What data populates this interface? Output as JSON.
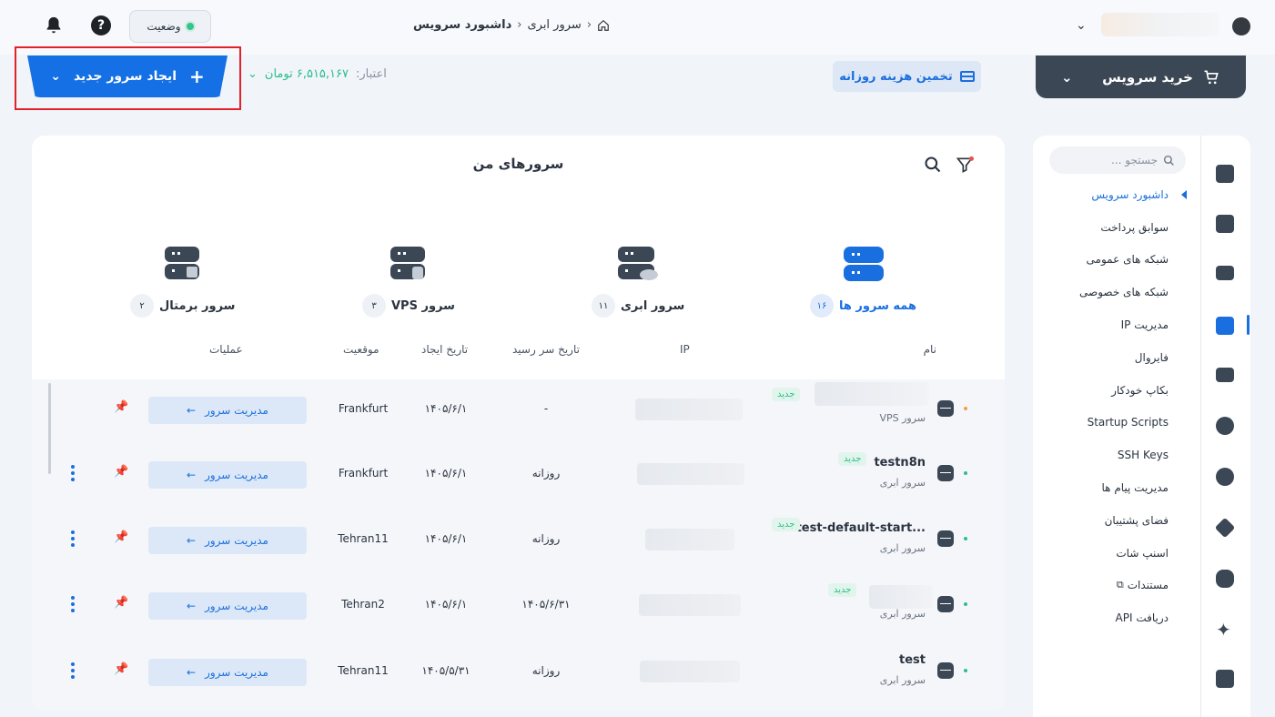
{
  "header": {
    "status_label": "وضعیت",
    "breadcrumb": [
      "داشبورد سرویس",
      "سرور ابری"
    ],
    "help_label": "?"
  },
  "actions": {
    "create_server": "ایجاد سرور جدید",
    "credit_label": "اعتبار:",
    "credit_value": "۶,۵۱۵,۱۶۷ تومان",
    "estimate_daily": "تخمین هزینه روزانه",
    "buy_service": "خرید سرویس"
  },
  "main": {
    "title": "سرورهای من",
    "categories": [
      {
        "label": "همه سرور ها",
        "count": "۱۶"
      },
      {
        "label": "سرور ابری",
        "count": "۱۱"
      },
      {
        "label": "سرور VPS",
        "count": "۳"
      },
      {
        "label": "سرور برمتال",
        "count": "۲"
      }
    ],
    "columns": {
      "name": "نام",
      "ip": "IP",
      "due": "تاریخ سر رسید",
      "created": "تاریخ ایجاد",
      "location": "موقعیت",
      "operations": "عملیات"
    },
    "new_badge": "جدید",
    "manage_label": "مدیریت سرور",
    "rows": [
      {
        "name": "",
        "type": "سرور VPS",
        "due": "-",
        "created": "۱۴۰۵/۶/۱",
        "location": "Frankfurt"
      },
      {
        "name": "testn8n",
        "type": "سرور ابری",
        "due": "روزانه",
        "created": "۱۴۰۵/۶/۱",
        "location": "Frankfurt"
      },
      {
        "name": "test-default-start...",
        "type": "سرور ابری",
        "due": "روزانه",
        "created": "۱۴۰۵/۶/۱",
        "location": "Tehran11"
      },
      {
        "name": "",
        "type": "سرور ابری",
        "due": "۱۴۰۵/۶/۳۱",
        "created": "۱۴۰۵/۶/۱",
        "location": "Tehran2"
      },
      {
        "name": "test",
        "type": "سرور ابری",
        "due": "روزانه",
        "created": "۱۴۰۵/۵/۳۱",
        "location": "Tehran11"
      }
    ]
  },
  "sidebar": {
    "search_placeholder": "جستجو ...",
    "items": [
      {
        "label": "داشبورد سرویس"
      },
      {
        "label": "سوابق پرداخت"
      },
      {
        "label": "شبکه های عمومی"
      },
      {
        "label": "شبکه های خصوصی"
      },
      {
        "label": "مدیریت IP"
      },
      {
        "label": "فایروال"
      },
      {
        "label": "بکاپ خودکار"
      },
      {
        "label": "Startup Scripts"
      },
      {
        "label": "SSH Keys"
      },
      {
        "label": "مدیریت پیام ها"
      },
      {
        "label": "فضای پشتیبان"
      },
      {
        "label": "اسنپ شات"
      },
      {
        "label": "مستندات"
      },
      {
        "label": "دریافت API"
      }
    ]
  },
  "colors": {
    "accent": "#1a6fe0",
    "success": "#2cbf8a",
    "dark": "#3b4754",
    "highlight": "#e2222a"
  }
}
